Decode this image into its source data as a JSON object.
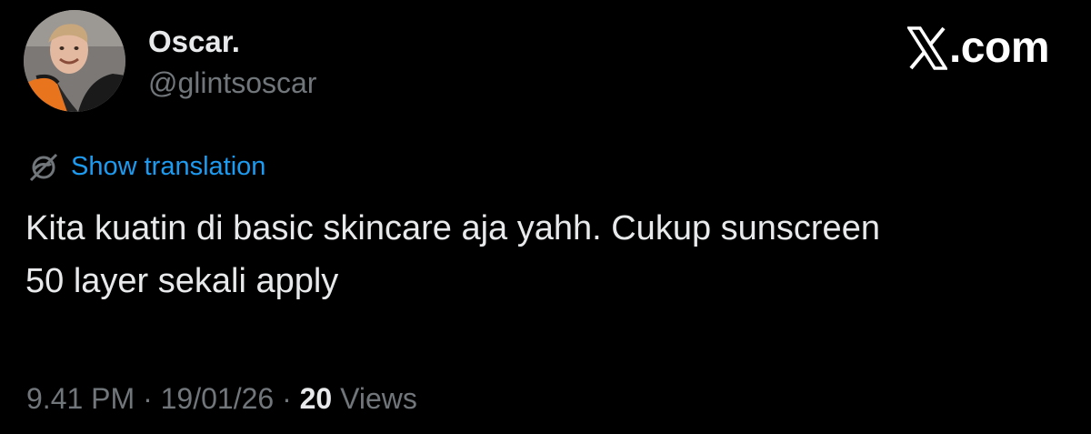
{
  "author": {
    "display_name": "Oscar.",
    "handle": "@glintsoscar"
  },
  "brand": {
    "logo_icon": "x-logo-icon",
    "label": ".com"
  },
  "translation": {
    "icon": "globe-icon",
    "label": "Show translation"
  },
  "tweet": {
    "lines": [
      "Kita kuatin di basic skincare aja yahh. Cukup sunscreen",
      "50 layer sekali apply"
    ]
  },
  "meta": {
    "time": "9.41 PM",
    "separator": " · ",
    "date": "19/01/26",
    "views_count": "20",
    "views_label": " Views"
  },
  "colors": {
    "background": "#000000",
    "primary_text": "#e7e9ea",
    "secondary_text": "#71767b",
    "link": "#1d9bf0"
  }
}
